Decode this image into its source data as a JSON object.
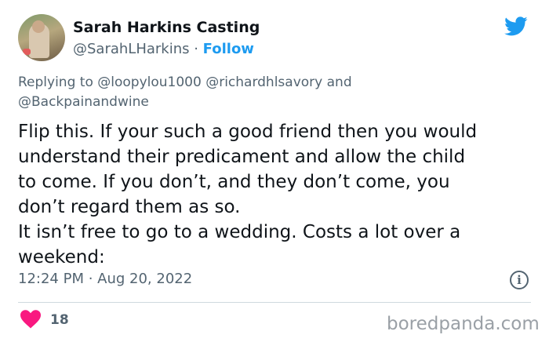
{
  "author": {
    "display_name": "Sarah Harkins Casting",
    "handle": "@SarahLHarkins",
    "separator": " · ",
    "follow_label": "Follow"
  },
  "reply": {
    "prefix": "Replying to ",
    "mention_1": "@loopylou1000",
    "mention_2": "@richardhlsavory",
    "joiner": " and",
    "mention_3": "@Backpainandwine"
  },
  "tweet": {
    "lines": [
      "Flip this. If your such a good friend then you would",
      "understand their predicament and allow the child",
      "to come. If you don’t, and they don’t come, you",
      "don’t regard them as so.",
      "It isn’t free to go to a wedding. Costs a lot over a",
      "weekend:"
    ]
  },
  "meta": {
    "time": "12:24 PM",
    "separator": " · ",
    "date": "Aug 20, 2022",
    "info_glyph": "i"
  },
  "engagement": {
    "likes": "18"
  },
  "watermark": "boredpanda.com",
  "colors": {
    "twitter_blue": "#1d9bf0",
    "like_red": "#f91880",
    "secondary_text": "#536471",
    "divider": "#cfd9de"
  },
  "icons": {
    "brand": "twitter-bird-icon",
    "like": "heart-icon",
    "info": "info-icon"
  }
}
